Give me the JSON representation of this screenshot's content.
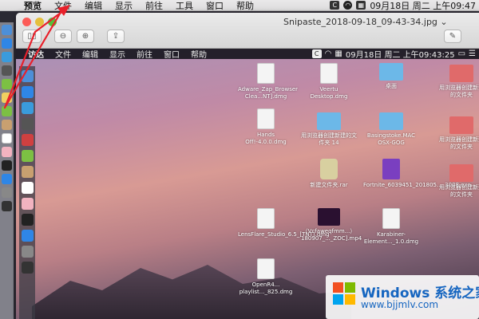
{
  "menubar": {
    "items": [
      "预览",
      "文件",
      "编辑",
      "显示",
      "前往",
      "工具",
      "窗口",
      "帮助"
    ],
    "datetime": "09月18日 周二 上午09:47"
  },
  "window": {
    "title": "Snipaste_2018-09-18_09-43-34.jpg"
  },
  "inner_menubar": {
    "items": [
      "访达",
      "文件",
      "编辑",
      "显示",
      "前往",
      "窗口",
      "帮助"
    ],
    "datetime": "09月18日 周二 上午09:43:25"
  },
  "files": [
    {
      "label": "Adware_Zap_Browser Clea...NT].dmg",
      "kind": "doc"
    },
    {
      "label": "Veertu Desktop.dmg",
      "kind": "doc"
    },
    {
      "label": "桌面",
      "kind": "folder"
    },
    {
      "label": "Hands Off!-4.0.0.dmg",
      "kind": "doc"
    },
    {
      "label": "用浏览器创建新建的文件夹 14",
      "kind": "folder"
    },
    {
      "label": "Basingstoke.MAC OSX-GOG",
      "kind": "folder"
    },
    {
      "label": "新建文件夹.rar",
      "kind": "doc"
    },
    {
      "label": "Fortnite_6039451_201805..._3008.exe",
      "kind": "app"
    },
    {
      "label": "LensFlare_Studio_6.5_[TNT].dmg",
      "kind": "doc"
    },
    {
      "label": "（Vcfaweqfmm...）180907_..._ZOC].mp4",
      "kind": "video"
    },
    {
      "label": "Karabiner-Element..._1.0.dmg",
      "kind": "doc"
    },
    {
      "label": "OpenR4... playlist..._825.dmg",
      "kind": "doc"
    }
  ],
  "right_edge_items": [
    "用浏览器创建新建的文件夹",
    "用浏览器创建新建的文件夹",
    "用浏览器创建新建的文件夹"
  ],
  "watermark": {
    "brand": "Windows 系统之家",
    "url": "www.bjjmlv.com"
  },
  "colors": {
    "annotation_arrow": "#e8202a",
    "watermark_blue": "#1565c0"
  }
}
